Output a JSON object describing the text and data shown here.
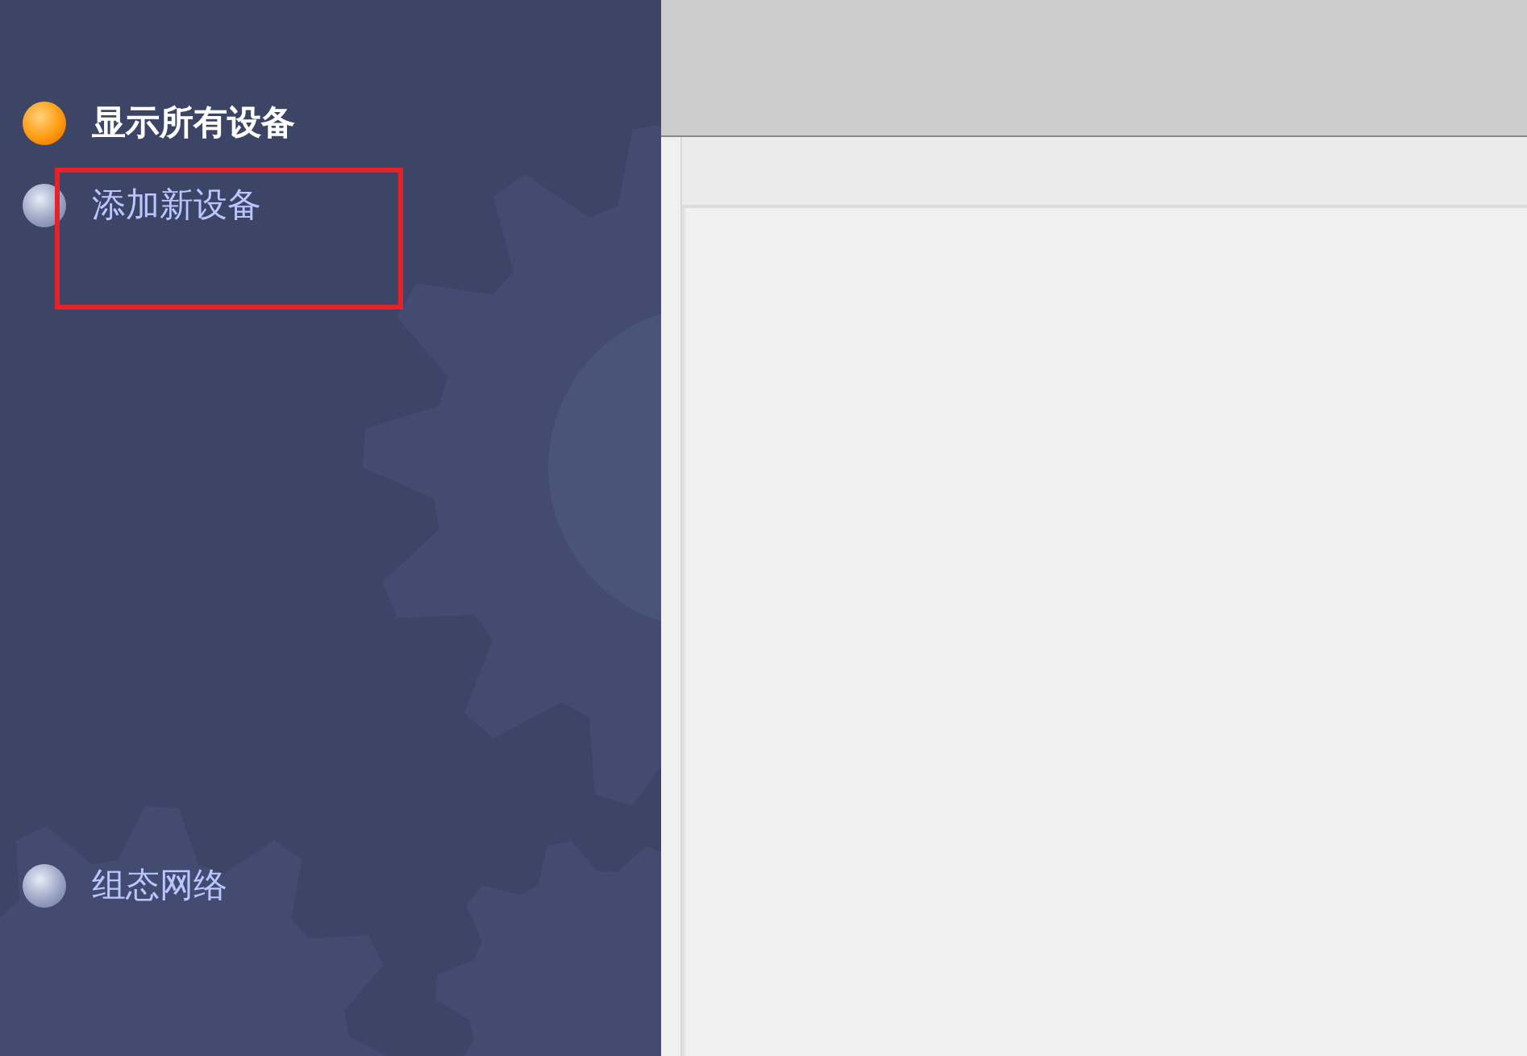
{
  "sidebar": {
    "top_items": [
      {
        "label": "显示所有设备",
        "selected": true
      },
      {
        "label": "添加新设备",
        "selected": false
      }
    ],
    "bottom_items": [
      {
        "label": "组态网络",
        "selected": false
      }
    ]
  }
}
